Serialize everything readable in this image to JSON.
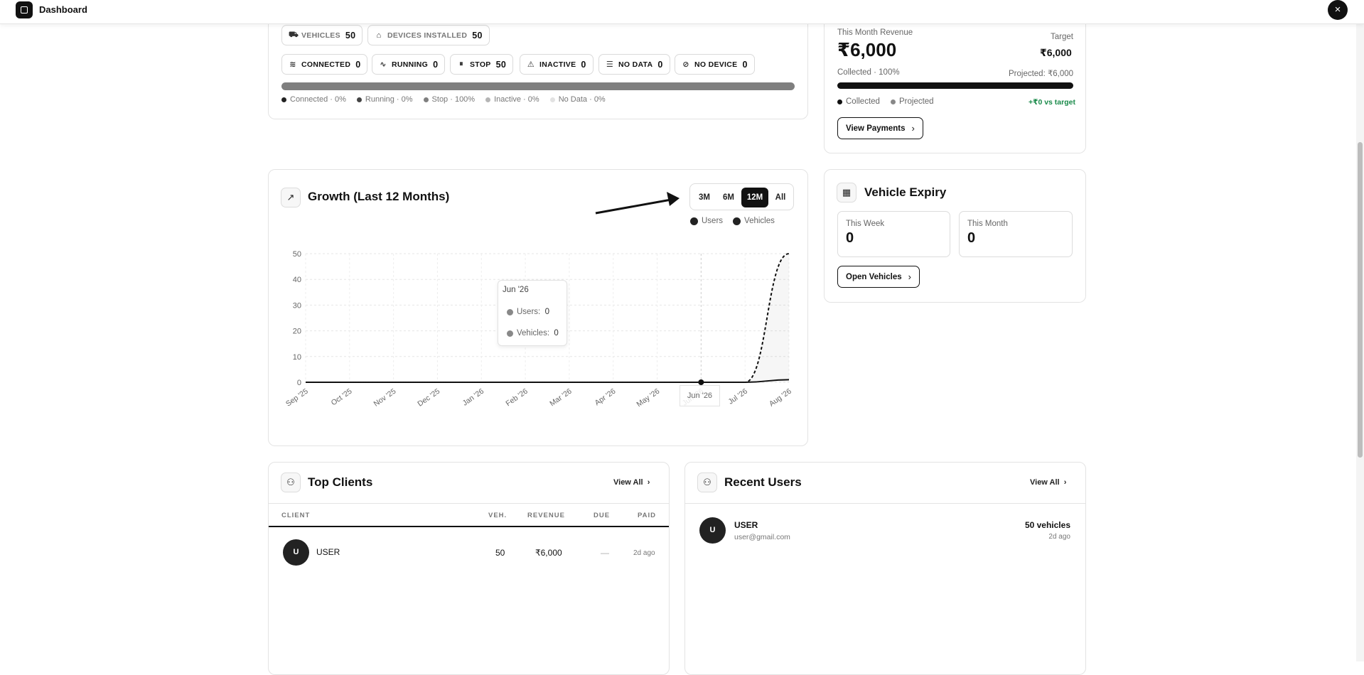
{
  "app": {
    "title": "Dashboard",
    "close_label": "×"
  },
  "fleet": {
    "chips_top": [
      {
        "label": "VEHICLES",
        "value": "50",
        "icon": "car-icon"
      },
      {
        "label": "DEVICES INSTALLED",
        "value": "50",
        "icon": "device-icon"
      }
    ],
    "chips_status": [
      {
        "label": "CONNECTED",
        "value": "0",
        "icon": "wifi-icon"
      },
      {
        "label": "RUNNING",
        "value": "0",
        "icon": "activity-icon"
      },
      {
        "label": "STOP",
        "value": "50",
        "icon": "pause-icon"
      },
      {
        "label": "INACTIVE",
        "value": "0",
        "icon": "warning-icon"
      },
      {
        "label": "NO DATA",
        "value": "0",
        "icon": "database-icon"
      },
      {
        "label": "NO DEVICE",
        "value": "0",
        "icon": "no-device-icon"
      }
    ],
    "legend": [
      {
        "label": "Connected · 0%",
        "color": "#222222"
      },
      {
        "label": "Running · 0%",
        "color": "#444444"
      },
      {
        "label": "Stop · 100%",
        "color": "#7f7f7f"
      },
      {
        "label": "Inactive · 0%",
        "color": "#b5b5b5"
      },
      {
        "label": "No Data · 0%",
        "color": "#e2e2e2"
      }
    ],
    "stop_fraction": 1.0
  },
  "revenue": {
    "label": "This Month Revenue",
    "amount": "₹6,000",
    "target_label": "Target",
    "target_value": "₹6,000",
    "collected": "Collected · 100%",
    "projected": "Projected: ₹6,000",
    "legend_collected": "Collected",
    "legend_projected": "Projected",
    "vs_target": "+₹0 vs target",
    "vs_target_color": "#1a8a4a",
    "button": "View Payments"
  },
  "growth": {
    "title": "Growth (Last 12 Months)",
    "ranges": [
      "3M",
      "6M",
      "12M",
      "All"
    ],
    "active_range": "12M",
    "legend": [
      "Users",
      "Vehicles"
    ],
    "tooltip": {
      "title": "Jun '26",
      "users_label": "Users:",
      "users_value": "0",
      "vehicles_label": "Vehicles:",
      "vehicles_value": "0"
    },
    "hover_label": "Jun '26"
  },
  "chart_data": {
    "type": "line",
    "x": [
      "Sep '25",
      "Oct '25",
      "Nov '25",
      "Dec '25",
      "Jan '26",
      "Feb '26",
      "Mar '26",
      "Apr '26",
      "May '26",
      "Jun '26",
      "Jul '26",
      "Aug '26"
    ],
    "series": [
      {
        "name": "Users",
        "values": [
          0,
          0,
          0,
          0,
          0,
          0,
          0,
          0,
          0,
          0,
          0,
          1
        ],
        "style": "solid"
      },
      {
        "name": "Vehicles",
        "values": [
          0,
          0,
          0,
          0,
          0,
          0,
          0,
          0,
          0,
          0,
          0,
          50
        ],
        "style": "dashed"
      }
    ],
    "yticks": [
      0,
      10,
      20,
      30,
      40,
      50
    ],
    "ylim": [
      0,
      50
    ],
    "grid": true,
    "legend_position": "top-right"
  },
  "expiry": {
    "title": "Vehicle Expiry",
    "this_week_label": "This Week",
    "this_week_value": "0",
    "this_month_label": "This Month",
    "this_month_value": "0",
    "button": "Open Vehicles"
  },
  "top_clients": {
    "title": "Top Clients",
    "view_all": "View All",
    "columns": [
      "CLIENT",
      "VEH.",
      "REVENUE",
      "DUE",
      "PAID"
    ],
    "rows": [
      {
        "avatar": "U",
        "client": "USER",
        "veh": "50",
        "revenue": "₹6,000",
        "due": "—",
        "paid": "2d ago"
      }
    ]
  },
  "recent_users": {
    "title": "Recent Users",
    "view_all": "View All",
    "rows": [
      {
        "avatar": "U",
        "name": "USER",
        "email": "user@gmail.com",
        "vehicles": "50 vehicles",
        "when": "2d ago"
      }
    ]
  }
}
